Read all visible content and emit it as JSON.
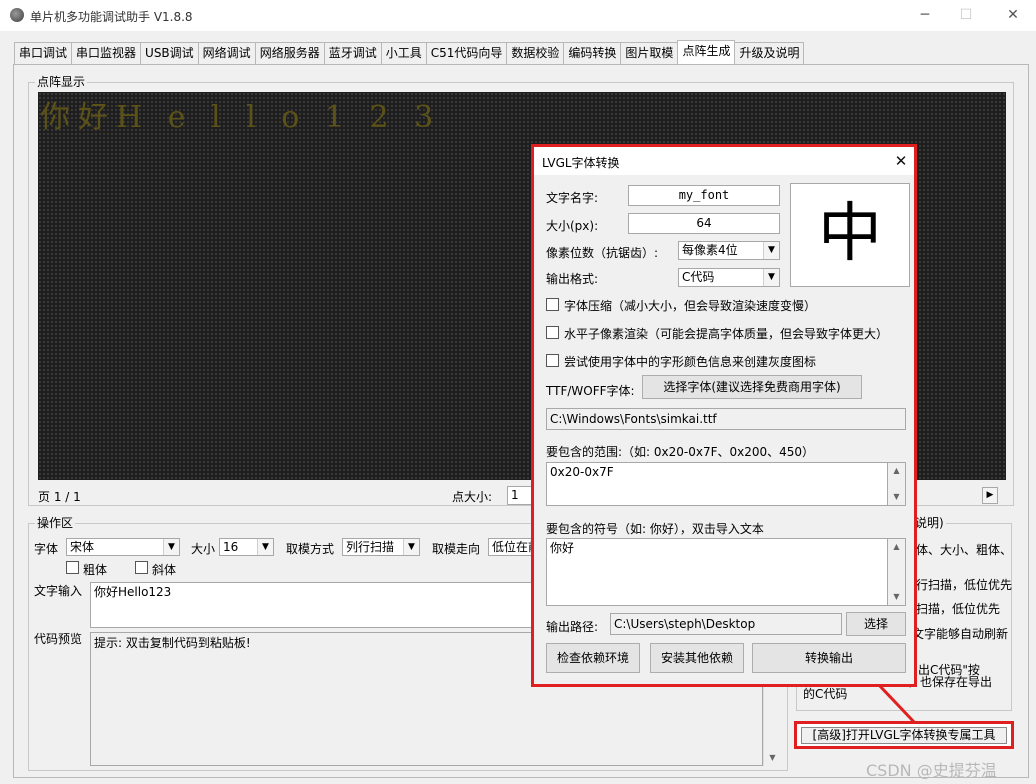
{
  "window": {
    "title": "单片机多功能调试助手 V1.8.8",
    "minimize": "─",
    "maximize": "☐",
    "close": "✕"
  },
  "tabs": [
    {
      "label": "串口调试"
    },
    {
      "label": "串口监视器"
    },
    {
      "label": "USB调试"
    },
    {
      "label": "网络调试"
    },
    {
      "label": "网络服务器"
    },
    {
      "label": "蓝牙调试"
    },
    {
      "label": "小工具"
    },
    {
      "label": "C51代码向导"
    },
    {
      "label": "数据校验"
    },
    {
      "label": "编码转换"
    },
    {
      "label": "图片取模"
    },
    {
      "label": "点阵生成",
      "active": true
    },
    {
      "label": "升级及说明"
    }
  ],
  "dot_display": {
    "group_label": "点阵显示",
    "rendered_text": "你好H e l l o 1 2 3",
    "page_info": "页 1 / 1",
    "dot_size_label": "点大小:",
    "dot_size_value": "1"
  },
  "operation": {
    "group_label": "操作区",
    "font_label": "字体",
    "font_value": "宋体",
    "size_label": "大小",
    "size_value": "16",
    "mode_label": "取模方式",
    "mode_value": "列行扫描",
    "direction_label": "取模走向",
    "direction_value": "低位在前",
    "bold_label": "粗体",
    "italic_label": "斜体",
    "text_input_label": "文字输入",
    "text_input_value": "你好Hello123",
    "code_preview_label": "代码预览",
    "code_preview_value": "提示: 双击复制代码到粘贴板!"
  },
  "side_panel": {
    "title_fragment": "说明)",
    "lines": [
      "体、大小、粗体、",
      "行扫描，低位优先",
      "扫描，低位优先",
      "文字能够自动刷新",
      "出C代码\"按",
      "，也保存在导出",
      "的C代码"
    ]
  },
  "lvgl_button_label": "[高级]打开LVGL字体转换专属工具",
  "dialog": {
    "title": "LVGL字体转换",
    "close": "✕",
    "font_name_label": "文字名字:",
    "font_name_value": "my_font",
    "size_label": "大小(px):",
    "size_value": "64",
    "bpp_label": "像素位数（抗锯齿）:",
    "bpp_value": "每像素4位",
    "format_label": "输出格式:",
    "format_value": "C代码",
    "preview_char": "中",
    "opt_compress": "字体压缩（减小大小，但会导致渲染速度变慢）",
    "opt_subpixel": "水平子像素渲染（可能会提高字体质量，但会导致字体更大）",
    "opt_color": "尝试使用字体中的字形颜色信息来创建灰度图标",
    "ttf_label": "TTF/WOFF字体:",
    "choose_font_button": "选择字体(建议选择免费商用字体)",
    "font_path": "C:\\Windows\\Fonts\\simkai.ttf",
    "range_label": "要包含的范围:（如: 0x20-0x7F、0x200、450）",
    "range_value": "0x20-0x7F",
    "symbols_label": "要包含的符号（如: 你好），双击导入文本",
    "symbols_value": "你好",
    "output_path_label": "输出路径:",
    "output_path_value": "C:\\Users\\steph\\Desktop",
    "select_button": "选择",
    "check_env_button": "检查依赖环境",
    "install_deps_button": "安装其他依赖",
    "convert_button": "转换输出"
  },
  "watermark": "CSDN @史提芬温",
  "colors": {
    "highlight": "#e02020",
    "dot_text": "#5c5218",
    "dot_background": "#1e1e1e"
  }
}
